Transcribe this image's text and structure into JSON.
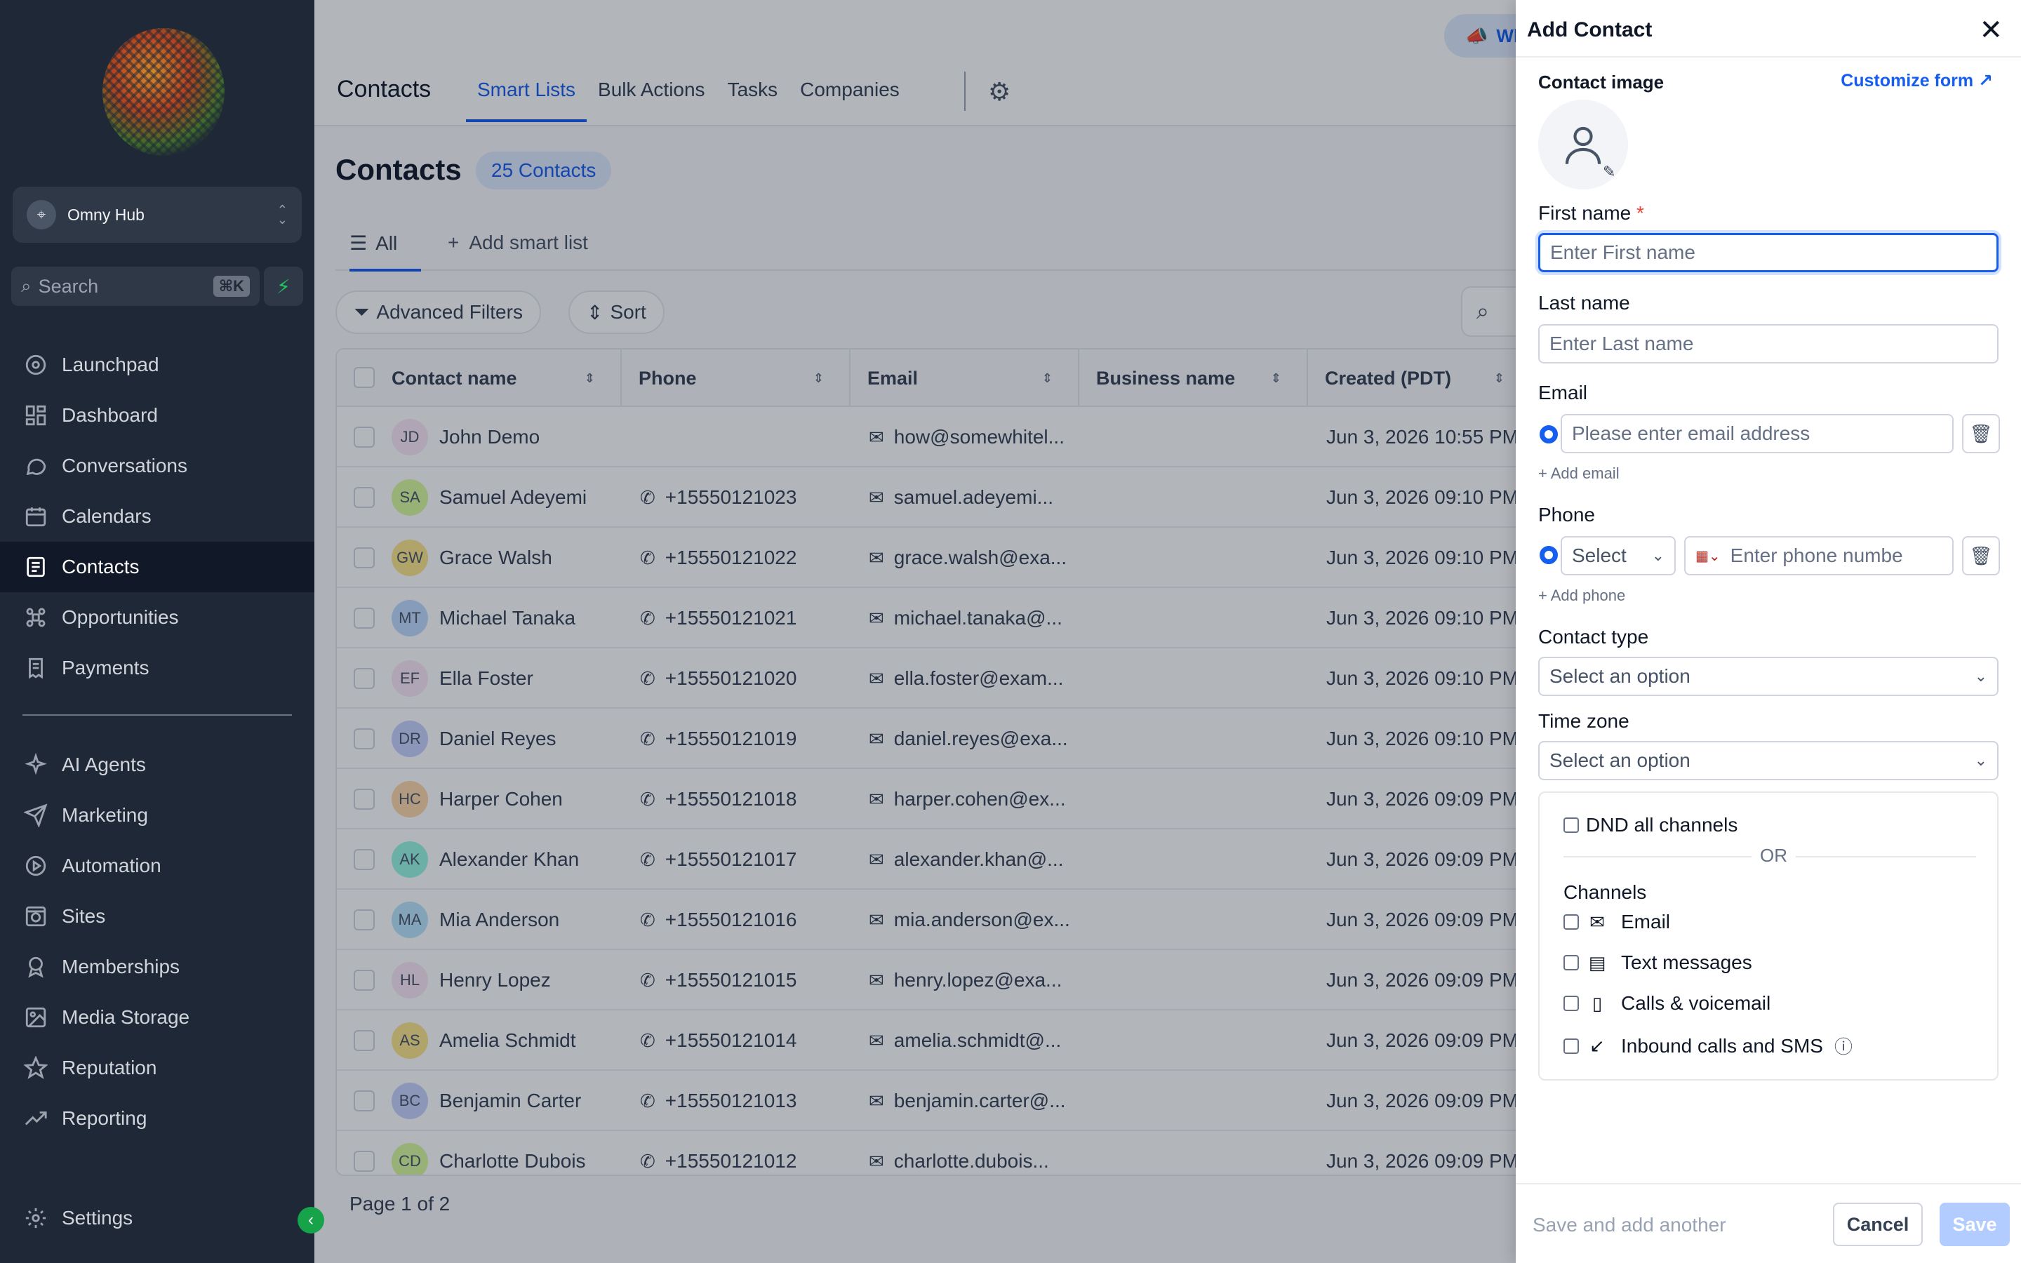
{
  "sidebar": {
    "account_name": "Omny Hub",
    "search_placeholder": "Search",
    "search_shortcut": "⌘K",
    "nav_top": [
      {
        "label": "Launchpad",
        "icon": "launchpad-icon"
      },
      {
        "label": "Dashboard",
        "icon": "dashboard-icon"
      },
      {
        "label": "Conversations",
        "icon": "chat-icon"
      },
      {
        "label": "Calendars",
        "icon": "calendar-icon"
      },
      {
        "label": "Contacts",
        "icon": "contacts-icon",
        "active": true
      },
      {
        "label": "Opportunities",
        "icon": "opportunities-icon"
      },
      {
        "label": "Payments",
        "icon": "payments-icon"
      }
    ],
    "nav_bottom": [
      {
        "label": "AI Agents",
        "icon": "sparkle-icon"
      },
      {
        "label": "Marketing",
        "icon": "send-icon"
      },
      {
        "label": "Automation",
        "icon": "automation-icon"
      },
      {
        "label": "Sites",
        "icon": "globe-icon"
      },
      {
        "label": "Memberships",
        "icon": "badge-icon"
      },
      {
        "label": "Media Storage",
        "icon": "image-icon"
      },
      {
        "label": "Reputation",
        "icon": "star-icon"
      },
      {
        "label": "Reporting",
        "icon": "trend-icon"
      }
    ],
    "settings_label": "Settings"
  },
  "topbar": {
    "title": "Contacts",
    "tabs": [
      "Smart Lists",
      "Bulk Actions",
      "Tasks",
      "Companies"
    ],
    "whats_new": "Wh"
  },
  "page": {
    "heading": "Contacts",
    "count": "25 Contacts",
    "list_all": "All",
    "add_smart_list": "Add smart list",
    "advanced_filters": "Advanced Filters",
    "sort": "Sort",
    "pager": "Page 1 of 2"
  },
  "table": {
    "columns": [
      "Contact name",
      "Phone",
      "Email",
      "Business name",
      "Created (PDT)"
    ],
    "rows": [
      {
        "initials": "JD",
        "color": "#fce7f6",
        "name": "John Demo",
        "phone": "",
        "email": "how@somewhitel...",
        "created": "Jun 3, 2026 10:55 PM"
      },
      {
        "initials": "SA",
        "color": "#d9f99d",
        "name": "Samuel Adeyemi",
        "phone": "+15550121023",
        "email": "samuel.adeyemi...",
        "created": "Jun 3, 2026 09:10 PM"
      },
      {
        "initials": "GW",
        "color": "#fde68a",
        "name": "Grace Walsh",
        "phone": "+15550121022",
        "email": "grace.walsh@exa...",
        "created": "Jun 3, 2026 09:10 PM"
      },
      {
        "initials": "MT",
        "color": "#bfdbfe",
        "name": "Michael Tanaka",
        "phone": "+15550121021",
        "email": "michael.tanaka@...",
        "created": "Jun 3, 2026 09:10 PM"
      },
      {
        "initials": "EF",
        "color": "#fce7f6",
        "name": "Ella Foster",
        "phone": "+15550121020",
        "email": "ella.foster@exam...",
        "created": "Jun 3, 2026 09:10 PM"
      },
      {
        "initials": "DR",
        "color": "#c7d2fe",
        "name": "Daniel Reyes",
        "phone": "+15550121019",
        "email": "daniel.reyes@exa...",
        "created": "Jun 3, 2026 09:10 PM"
      },
      {
        "initials": "HC",
        "color": "#fed7aa",
        "name": "Harper Cohen",
        "phone": "+15550121018",
        "email": "harper.cohen@ex...",
        "created": "Jun 3, 2026 09:09 PM"
      },
      {
        "initials": "AK",
        "color": "#99f6e4",
        "name": "Alexander Khan",
        "phone": "+15550121017",
        "email": "alexander.khan@...",
        "created": "Jun 3, 2026 09:09 PM"
      },
      {
        "initials": "MA",
        "color": "#bae6fd",
        "name": "Mia Anderson",
        "phone": "+15550121016",
        "email": "mia.anderson@ex...",
        "created": "Jun 3, 2026 09:09 PM"
      },
      {
        "initials": "HL",
        "color": "#fce7f6",
        "name": "Henry Lopez",
        "phone": "+15550121015",
        "email": "henry.lopez@exa...",
        "created": "Jun 3, 2026 09:09 PM"
      },
      {
        "initials": "AS",
        "color": "#fde68a",
        "name": "Amelia Schmidt",
        "phone": "+15550121014",
        "email": "amelia.schmidt@...",
        "created": "Jun 3, 2026 09:09 PM"
      },
      {
        "initials": "BC",
        "color": "#c7d2fe",
        "name": "Benjamin Carter",
        "phone": "+15550121013",
        "email": "benjamin.carter@...",
        "created": "Jun 3, 2026 09:09 PM"
      },
      {
        "initials": "CD",
        "color": "#d9f99d",
        "name": "Charlotte Dubois",
        "phone": "+15550121012",
        "email": "charlotte.dubois...",
        "created": "Jun 3, 2026 09:09 PM"
      }
    ]
  },
  "drawer": {
    "title": "Add Contact",
    "customize": "Customize form",
    "contact_image": "Contact image",
    "first_name_label": "First name",
    "required_mark": "*",
    "first_name_placeholder": "Enter First name",
    "last_name_label": "Last name",
    "last_name_placeholder": "Enter Last name",
    "email_label": "Email",
    "email_placeholder": "Please enter email address",
    "add_email": "+ Add email",
    "phone_label": "Phone",
    "phone_type": "Select",
    "phone_placeholder": "Enter phone numbe",
    "add_phone": "+ Add phone",
    "contact_type_label": "Contact type",
    "contact_type_value": "Select an option",
    "time_zone_label": "Time zone",
    "time_zone_value": "Select an option",
    "dnd_all": "DND all channels",
    "or": "OR",
    "channels_label": "Channels",
    "channels": [
      {
        "label": "Email",
        "icon": "mail-icon"
      },
      {
        "label": "Text messages",
        "icon": "message-icon"
      },
      {
        "label": "Calls & voicemail",
        "icon": "phone-device-icon"
      },
      {
        "label": "Inbound calls and SMS",
        "icon": "inbound-arrow-icon"
      }
    ],
    "save_and_add": "Save and add another",
    "cancel": "Cancel",
    "save": "Save"
  }
}
